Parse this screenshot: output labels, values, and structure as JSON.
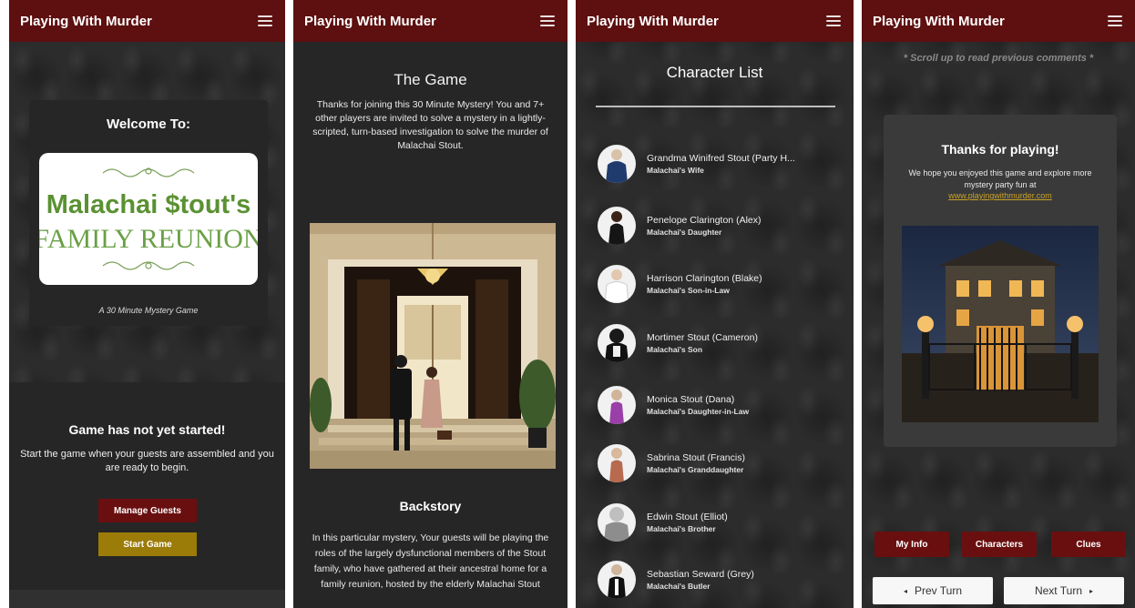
{
  "app_title": "Playing With Murder",
  "screens": {
    "lobby": {
      "welcome_heading": "Welcome To:",
      "logo_line1": "Malachai $tout's",
      "logo_line2": "FAMILY REUNION",
      "subtitle": "A 30 Minute Mystery Game",
      "status_heading": "Game has not yet started!",
      "status_text": "Start the game when your guests are assembled and you are ready to begin.",
      "manage_guests_label": "Manage Guests",
      "start_game_label": "Start Game"
    },
    "intro": {
      "game_heading": "The Game",
      "game_text": "Thanks for joining this 30 Minute Mystery! You and 7+ other players are invited to solve a mystery in a lightly-scripted, turn-based investigation to solve the murder of Malachai Stout.",
      "backstory_heading": "Backstory",
      "backstory_text": "In this particular mystery, Your guests will be playing the roles of the largely dysfunctional members of the Stout family, who have gathered at their ancestral home for a family reunion, hosted by the elderly Malachai Stout"
    },
    "characters": {
      "heading": "Character List",
      "list": [
        {
          "name": "Grandma Winifred Stout (Party H...",
          "role": "Malachai's Wife"
        },
        {
          "name": "Penelope Clarington (Alex)",
          "role": "Malachai's Daughter"
        },
        {
          "name": "Harrison Clarington (Blake)",
          "role": "Malachai's Son-in-Law"
        },
        {
          "name": "Mortimer Stout (Cameron)",
          "role": "Malachai's Son"
        },
        {
          "name": "Monica Stout (Dana)",
          "role": "Malachai's Daughter-in-Law"
        },
        {
          "name": "Sabrina Stout (Francis)",
          "role": "Malachai's Granddaughter"
        },
        {
          "name": "Edwin Stout (Elliot)",
          "role": "Malachai's Brother"
        },
        {
          "name": "Sebastian Seward (Grey)",
          "role": "Malachai's Butler"
        }
      ]
    },
    "end": {
      "scroll_note": "* Scroll up to read previous comments *",
      "thanks_heading": "Thanks for playing!",
      "thanks_text": "We hope you enjoyed this game and explore more mystery party fun at",
      "link_text": "www.playingwithmurder.com",
      "tab_my_info": "My Info",
      "tab_characters": "Characters",
      "tab_clues": "Clues",
      "prev_turn_label": "Prev Turn",
      "next_turn_label": "Next Turn"
    }
  },
  "colors": {
    "header": "#5e0f0f",
    "button_red": "#6a0f0f",
    "button_gold": "#9c7c08",
    "panel_dark": "#262626",
    "link_gold": "#c9a227"
  }
}
